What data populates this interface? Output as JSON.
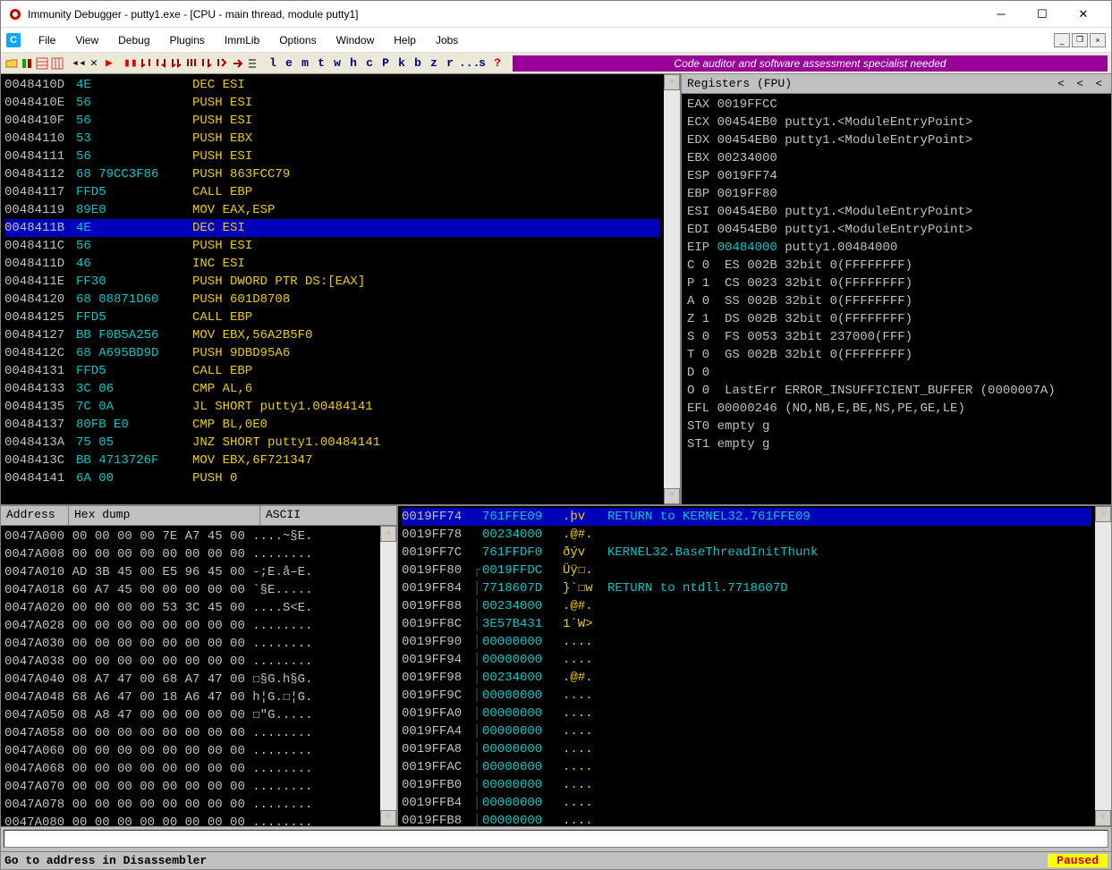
{
  "title": "Immunity Debugger - putty1.exe - [CPU - main thread, module putty1]",
  "menu": [
    "File",
    "View",
    "Debug",
    "Plugins",
    "ImmLib",
    "Options",
    "Window",
    "Help",
    "Jobs"
  ],
  "toolbar_letters": [
    "l",
    "e",
    "m",
    "t",
    "w",
    "h",
    "c",
    "P",
    "k",
    "b",
    "z",
    "r",
    "...",
    "s"
  ],
  "toolbar_banner": "Code auditor and software assessment specialist needed",
  "cpu": [
    {
      "addr": "0048410D",
      "bytes": "4E",
      "mnem": "DEC ESI"
    },
    {
      "addr": "0048410E",
      "bytes": "56",
      "mnem": "PUSH ESI"
    },
    {
      "addr": "0048410F",
      "bytes": "56",
      "mnem": "PUSH ESI"
    },
    {
      "addr": "00484110",
      "bytes": "53",
      "mnem": "PUSH EBX"
    },
    {
      "addr": "00484111",
      "bytes": "56",
      "mnem": "PUSH ESI"
    },
    {
      "addr": "00484112",
      "bytes": "68 79CC3F86",
      "mnem": "PUSH 863FCC79"
    },
    {
      "addr": "00484117",
      "bytes": "FFD5",
      "mnem": "CALL EBP"
    },
    {
      "addr": "00484119",
      "bytes": "89E0",
      "mnem": "MOV EAX,ESP"
    },
    {
      "addr": "0048411B",
      "bytes": "4E",
      "mnem": "DEC ESI",
      "sel": true
    },
    {
      "addr": "0048411C",
      "bytes": "56",
      "mnem": "PUSH ESI"
    },
    {
      "addr": "0048411D",
      "bytes": "46",
      "mnem": "INC ESI"
    },
    {
      "addr": "0048411E",
      "bytes": "FF30",
      "mnem": "PUSH DWORD PTR DS:[EAX]"
    },
    {
      "addr": "00484120",
      "bytes": "68 08871D60",
      "mnem": "PUSH 601D8708"
    },
    {
      "addr": "00484125",
      "bytes": "FFD5",
      "mnem": "CALL EBP"
    },
    {
      "addr": "00484127",
      "bytes": "BB F0B5A256",
      "mnem": "MOV EBX,56A2B5F0"
    },
    {
      "addr": "0048412C",
      "bytes": "68 A695BD9D",
      "mnem": "PUSH 9DBD95A6"
    },
    {
      "addr": "00484131",
      "bytes": "FFD5",
      "mnem": "CALL EBP"
    },
    {
      "addr": "00484133",
      "bytes": "3C 06",
      "mnem": "CMP AL,6"
    },
    {
      "addr": "00484135",
      "bytes": "7C 0A",
      "mnem": "JL SHORT putty1.00484141"
    },
    {
      "addr": "00484137",
      "bytes": "80FB E0",
      "mnem": "CMP BL,0E0"
    },
    {
      "addr": "0048413A",
      "bytes": "75 05",
      "mnem": "JNZ SHORT putty1.00484141"
    },
    {
      "addr": "0048413C",
      "bytes": "BB 4713726F",
      "mnem": "MOV EBX,6F721347"
    },
    {
      "addr": "00484141",
      "bytes": "6A 00",
      "mnem": "PUSH 0"
    }
  ],
  "registers_title": "Registers (FPU)",
  "registers": [
    "EAX 0019FFCC",
    "ECX 00454EB0 putty1.<ModuleEntryPoint>",
    "EDX 00454EB0 putty1.<ModuleEntryPoint>",
    "EBX 00234000",
    "ESP 0019FF74",
    "EBP 0019FF80",
    "ESI 00454EB0 putty1.<ModuleEntryPoint>",
    "EDI 00454EB0 putty1.<ModuleEntryPoint>",
    "",
    {
      "eip": "EIP ",
      "val": "00484000",
      "rest": " putty1.00484000"
    },
    "",
    "C 0  ES 002B 32bit 0(FFFFFFFF)",
    "P 1  CS 0023 32bit 0(FFFFFFFF)",
    "A 0  SS 002B 32bit 0(FFFFFFFF)",
    "Z 1  DS 002B 32bit 0(FFFFFFFF)",
    "S 0  FS 0053 32bit 237000(FFF)",
    "T 0  GS 002B 32bit 0(FFFFFFFF)",
    "D 0",
    "O 0  LastErr ERROR_INSUFFICIENT_BUFFER (0000007A)",
    "",
    "EFL 00000246 (NO,NB,E,BE,NS,PE,GE,LE)",
    "",
    "ST0 empty g",
    "ST1 empty g"
  ],
  "dump_header": {
    "addr": "Address",
    "hex": "Hex dump",
    "ascii": "ASCII"
  },
  "dump": [
    "0047A000 00 00 00 00 7E A7 45 00 ....~§E.",
    "0047A008 00 00 00 00 00 00 00 00 ........",
    "0047A010 AD 3B 45 00 E5 96 45 00 -;E.å–E.",
    "0047A018 60 A7 45 00 00 00 00 00 `§E.....",
    "0047A020 00 00 00 00 53 3C 45 00 ....S<E.",
    "0047A028 00 00 00 00 00 00 00 00 ........",
    "0047A030 00 00 00 00 00 00 00 00 ........",
    "0047A038 00 00 00 00 00 00 00 00 ........",
    "0047A040 08 A7 47 00 68 A7 47 00 ☐§G.h§G.",
    "0047A048 68 A6 47 00 18 A6 47 00 h¦G.☐¦G.",
    "0047A050 08 A8 47 00 00 00 00 00 ☐\"G.....",
    "0047A058 00 00 00 00 00 00 00 00 ........",
    "0047A060 00 00 00 00 00 00 00 00 ........",
    "0047A068 00 00 00 00 00 00 00 00 ........",
    "0047A070 00 00 00 00 00 00 00 00 ........",
    "0047A078 00 00 00 00 00 00 00 00 ........",
    "0047A080 00 00 00 00 00 00 00 00 ........"
  ],
  "stack": [
    {
      "addr": "0019FF74",
      "val": "761FFE09",
      "asc": ".þv",
      "cmt": "RETURN to KERNEL32.761FFE09",
      "sel": true,
      "sep": " "
    },
    {
      "addr": "0019FF78",
      "val": "00234000",
      "asc": ".@#.",
      "cmt": "",
      "sep": " "
    },
    {
      "addr": "0019FF7C",
      "val": "761FFDF0",
      "asc": "ðýv",
      "cmt": "KERNEL32.BaseThreadInitThunk",
      "sep": " "
    },
    {
      "addr": "0019FF80",
      "val": "0019FFDC",
      "asc": "Üÿ☐.",
      "cmt": "",
      "sep": "┌"
    },
    {
      "addr": "0019FF84",
      "val": "7718607D",
      "asc": "}`☐w",
      "cmt": "RETURN to ntdll.7718607D",
      "sep": "│"
    },
    {
      "addr": "0019FF88",
      "val": "00234000",
      "asc": ".@#.",
      "cmt": "",
      "sep": "│"
    },
    {
      "addr": "0019FF8C",
      "val": "3E57B431",
      "asc": "1´W>",
      "cmt": "",
      "sep": "│"
    },
    {
      "addr": "0019FF90",
      "val": "00000000",
      "asc": "....",
      "cmt": "",
      "sep": "│"
    },
    {
      "addr": "0019FF94",
      "val": "00000000",
      "asc": "....",
      "cmt": "",
      "sep": "│"
    },
    {
      "addr": "0019FF98",
      "val": "00234000",
      "asc": ".@#.",
      "cmt": "",
      "sep": "│"
    },
    {
      "addr": "0019FF9C",
      "val": "00000000",
      "asc": "....",
      "cmt": "",
      "sep": "│"
    },
    {
      "addr": "0019FFA0",
      "val": "00000000",
      "asc": "....",
      "cmt": "",
      "sep": "│"
    },
    {
      "addr": "0019FFA4",
      "val": "00000000",
      "asc": "....",
      "cmt": "",
      "sep": "│"
    },
    {
      "addr": "0019FFA8",
      "val": "00000000",
      "asc": "....",
      "cmt": "",
      "sep": "│"
    },
    {
      "addr": "0019FFAC",
      "val": "00000000",
      "asc": "....",
      "cmt": "",
      "sep": "│"
    },
    {
      "addr": "0019FFB0",
      "val": "00000000",
      "asc": "....",
      "cmt": "",
      "sep": "│"
    },
    {
      "addr": "0019FFB4",
      "val": "00000000",
      "asc": "....",
      "cmt": "",
      "sep": "│"
    },
    {
      "addr": "0019FFB8",
      "val": "00000000",
      "asc": "....",
      "cmt": "",
      "sep": "│"
    }
  ],
  "cmd_placeholder": "",
  "status_left": "Go to address in Disassembler",
  "status_right": "Paused"
}
